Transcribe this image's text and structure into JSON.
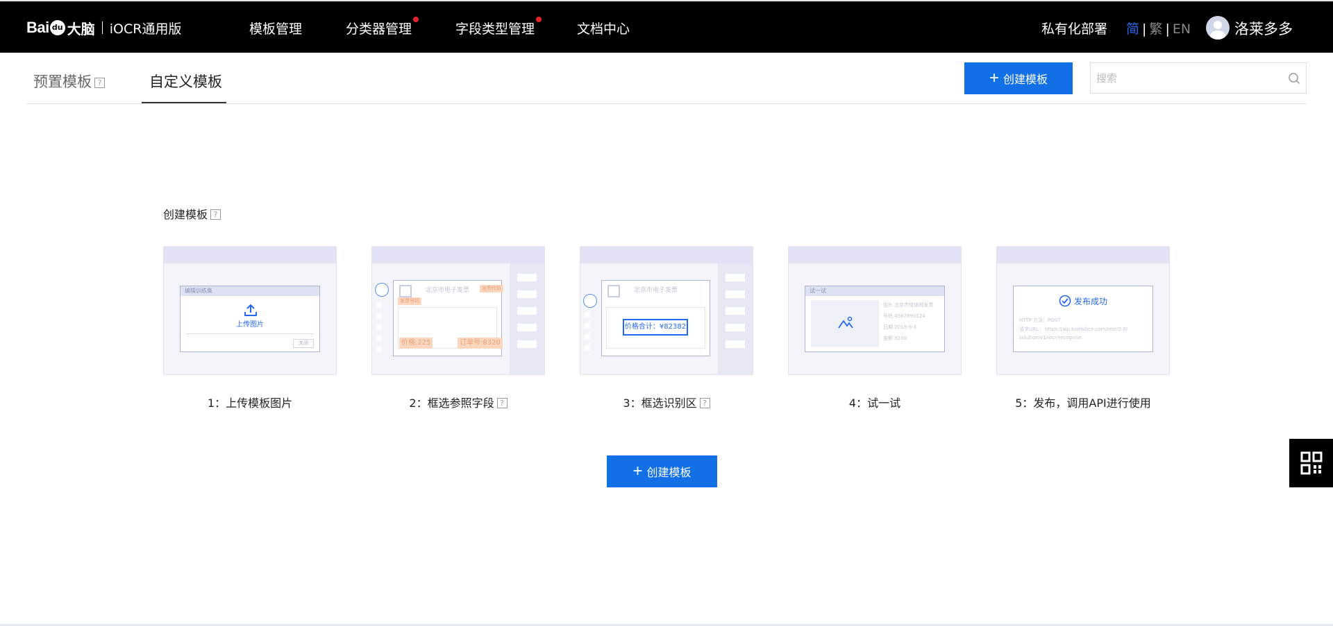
{
  "brand": {
    "bai": "Bai",
    "du": "du",
    "danao": "大脑",
    "product": "iOCR通用版"
  },
  "nav": {
    "items": [
      {
        "label": "模板管理",
        "badge": false
      },
      {
        "label": "分类器管理",
        "badge": true
      },
      {
        "label": "字段类型管理",
        "badge": true
      },
      {
        "label": "文档中心",
        "badge": false
      }
    ],
    "private_deploy": "私有化部署",
    "lang": {
      "simplified": "简",
      "traditional": "繁",
      "english": "EN",
      "separator": "|"
    },
    "username": "洛莱多多"
  },
  "tabs": [
    {
      "label": "预置模板",
      "help": "?"
    },
    {
      "label": "自定义模板"
    }
  ],
  "toolbar": {
    "create_label": "创建模板",
    "search_placeholder": "搜索"
  },
  "section": {
    "title": "创建模板",
    "help": "?"
  },
  "steps": [
    {
      "label": "1：上传模板图片",
      "win_title": "编辑训练集",
      "upload_text": "上传图片",
      "close_text": "关闭"
    },
    {
      "label": "2：框选参照字段",
      "help": "?",
      "doc_title": "北京市电子发票",
      "tag_a": "发票代码",
      "tag_b": "发票号码",
      "price_tag": "价格:225",
      "order_tag": "订单号:8320"
    },
    {
      "label": "3：框选识别区",
      "help": "?",
      "doc_title": "北京市电子发票",
      "selection_text": "价格合计：¥82382"
    },
    {
      "label": "4：试一试",
      "win_title": "试一试",
      "fields": [
        "抬头  北京市增值税发票",
        "号码  4567890124",
        "日期  2019-6-3",
        "金额  3200"
      ]
    },
    {
      "label": "5：发布，调用API进行使用",
      "success_text": "发布成功",
      "method_line": "HTTP 方法：POST",
      "url_line": "请求URL：  https://aip.baidubce.com/rest/2.0/",
      "url_line2": "solution/v1/iocr/recognise"
    }
  ],
  "main": {
    "create_label": "创建模板"
  },
  "colors": {
    "primary": "#1170e6",
    "topbar": "#000000",
    "lang_active": "#2468f2",
    "badge": "#e5232e"
  }
}
